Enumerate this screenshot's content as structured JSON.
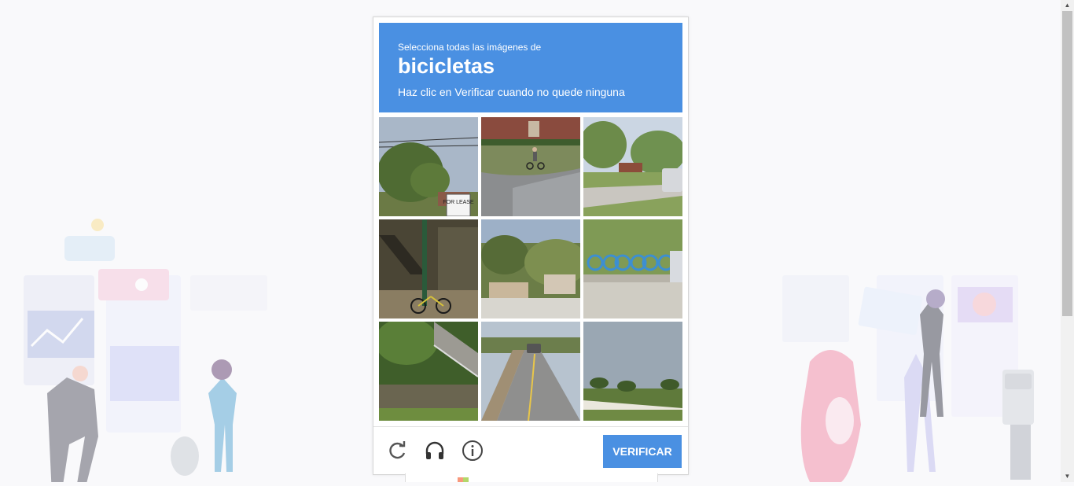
{
  "captcha": {
    "instruction_line1": "Selecciona todas las imágenes de",
    "target_object": "bicicletas",
    "instruction_line3": "Haz clic en Verificar cuando no quede ninguna",
    "tile_sign_text": "FOR LEASE",
    "verify_label": "VERIFICAR",
    "controls": [
      "refresh-icon",
      "headphones-icon",
      "info-icon"
    ],
    "accent_color": "#4a90e2"
  }
}
